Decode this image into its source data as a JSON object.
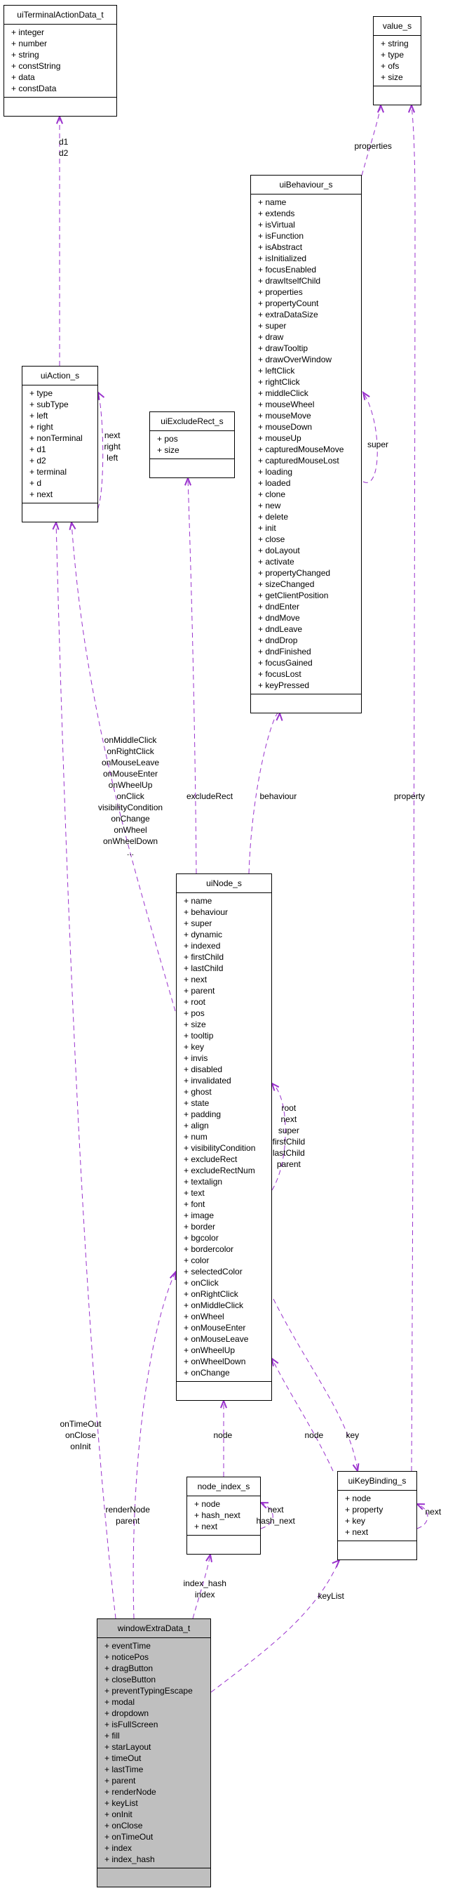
{
  "diagram": {
    "edge_color": "#9a32cd",
    "highlight_fill": "#bfbfbf"
  },
  "classes": {
    "uiTerminalActionData_t": {
      "name": "uiTerminalActionData_t",
      "attributes": [
        "+ integer",
        "+ number",
        "+ string",
        "+ constString",
        "+ data",
        "+ constData"
      ]
    },
    "value_s": {
      "name": "value_s",
      "attributes": [
        "+ string",
        "+ type",
        "+ ofs",
        "+ size"
      ]
    },
    "uiBehaviour_s": {
      "name": "uiBehaviour_s",
      "attributes": [
        "+ name",
        "+ extends",
        "+ isVirtual",
        "+ isFunction",
        "+ isAbstract",
        "+ isInitialized",
        "+ focusEnabled",
        "+ drawItselfChild",
        "+ properties",
        "+ propertyCount",
        "+ extraDataSize",
        "+ super",
        "+ draw",
        "+ drawTooltip",
        "+ drawOverWindow",
        "+ leftClick",
        "+ rightClick",
        "+ middleClick",
        "+ mouseWheel",
        "+ mouseMove",
        "+ mouseDown",
        "+ mouseUp",
        "+ capturedMouseMove",
        "+ capturedMouseLost",
        "+ loading",
        "+ loaded",
        "+ clone",
        "+ new",
        "+ delete",
        "+ init",
        "+ close",
        "+ doLayout",
        "+ activate",
        "+ propertyChanged",
        "+ sizeChanged",
        "+ getClientPosition",
        "+ dndEnter",
        "+ dndMove",
        "+ dndLeave",
        "+ dndDrop",
        "+ dndFinished",
        "+ focusGained",
        "+ focusLost",
        "+ keyPressed"
      ]
    },
    "uiAction_s": {
      "name": "uiAction_s",
      "attributes": [
        "+ type",
        "+ subType",
        "+ left",
        "+ right",
        "+ nonTerminal",
        "+ d1",
        "+ d2",
        "+ terminal",
        "+ d",
        "+ next"
      ]
    },
    "uiExcludeRect_s": {
      "name": "uiExcludeRect_s",
      "attributes": [
        "+ pos",
        "+ size"
      ]
    },
    "uiNode_s": {
      "name": "uiNode_s",
      "attributes": [
        "+ name",
        "+ behaviour",
        "+ super",
        "+ dynamic",
        "+ indexed",
        "+ firstChild",
        "+ lastChild",
        "+ next",
        "+ parent",
        "+ root",
        "+ pos",
        "+ size",
        "+ tooltip",
        "+ key",
        "+ invis",
        "+ disabled",
        "+ invalidated",
        "+ ghost",
        "+ state",
        "+ padding",
        "+ align",
        "+ num",
        "+ visibilityCondition",
        "+ excludeRect",
        "+ excludeRectNum",
        "+ textalign",
        "+ text",
        "+ font",
        "+ image",
        "+ border",
        "+ bgcolor",
        "+ bordercolor",
        "+ color",
        "+ selectedColor",
        "+ onClick",
        "+ onRightClick",
        "+ onMiddleClick",
        "+ onWheel",
        "+ onMouseEnter",
        "+ onMouseLeave",
        "+ onWheelUp",
        "+ onWheelDown",
        "+ onChange"
      ]
    },
    "node_index_s": {
      "name": "node_index_s",
      "attributes": [
        "+ node",
        "+ hash_next",
        "+ next"
      ]
    },
    "uiKeyBinding_s": {
      "name": "uiKeyBinding_s",
      "attributes": [
        "+ node",
        "+ property",
        "+ key",
        "+ next"
      ]
    },
    "windowExtraData_t": {
      "name": "windowExtraData_t",
      "attributes": [
        "+ eventTime",
        "+ noticePos",
        "+ dragButton",
        "+ closeButton",
        "+ preventTypingEscape",
        "+ modal",
        "+ dropdown",
        "+ isFullScreen",
        "+ fill",
        "+ starLayout",
        "+ timeOut",
        "+ lastTime",
        "+ parent",
        "+ renderNode",
        "+ keyList",
        "+ onInit",
        "+ onClose",
        "+ onTimeOut",
        "+ index",
        "+ index_hash"
      ]
    }
  },
  "edge_labels": {
    "d1_d2": [
      "d1",
      "d2"
    ],
    "properties": [
      "properties"
    ],
    "action_self": [
      "next",
      "right",
      "left"
    ],
    "behaviour_super": [
      "super"
    ],
    "node_actions": [
      "onMiddleClick",
      "onRightClick",
      "onMouseLeave",
      "onMouseEnter",
      "onWheelUp",
      "onClick",
      "visibilityCondition",
      "onChange",
      "onWheel",
      "onWheelDown",
      "..."
    ],
    "excludeRect": [
      "excludeRect"
    ],
    "behaviour": [
      "behaviour"
    ],
    "property": [
      "property"
    ],
    "node_self": [
      "root",
      "next",
      "super",
      "firstChild",
      "lastChild",
      "parent"
    ],
    "window_actions": [
      "onTimeOut",
      "onClose",
      "onInit"
    ],
    "nodeindex_node": [
      "node"
    ],
    "keybinding_node": [
      "node"
    ],
    "key": [
      "key"
    ],
    "render_parent": [
      "renderNode",
      "parent"
    ],
    "index_self": [
      "next",
      "hash_next"
    ],
    "keybinding_self": [
      "next"
    ],
    "index_hash": [
      "index_hash",
      "index"
    ],
    "keyList": [
      "keyList"
    ]
  }
}
